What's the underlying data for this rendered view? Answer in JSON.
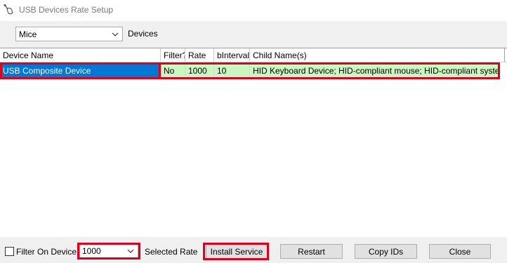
{
  "window": {
    "title": "USB Devices Rate Setup"
  },
  "device_type": {
    "selected": "Mice",
    "label": "Devices"
  },
  "table": {
    "columns": [
      "Device Name",
      "Filter?",
      "Rate",
      "bInterval",
      "Child Name(s)"
    ],
    "rows": [
      {
        "device_name": "USB Composite Device",
        "filter": "No",
        "rate": "1000",
        "binterval": "10",
        "child_names": "HID Keyboard Device; HID-compliant mouse; HID-compliant system controller"
      }
    ]
  },
  "footer": {
    "filter_label": "Filter On Device",
    "filter_checked": false,
    "rate_value": "1000",
    "rate_label": "Selected Rate",
    "install_label": "Install Service",
    "restart_label": "Restart",
    "copy_ids_label": "Copy IDs",
    "close_label": "Close"
  },
  "colors": {
    "selection": "#0078d7",
    "row_background": "#c9f7c1",
    "highlight": "#e0001b"
  }
}
